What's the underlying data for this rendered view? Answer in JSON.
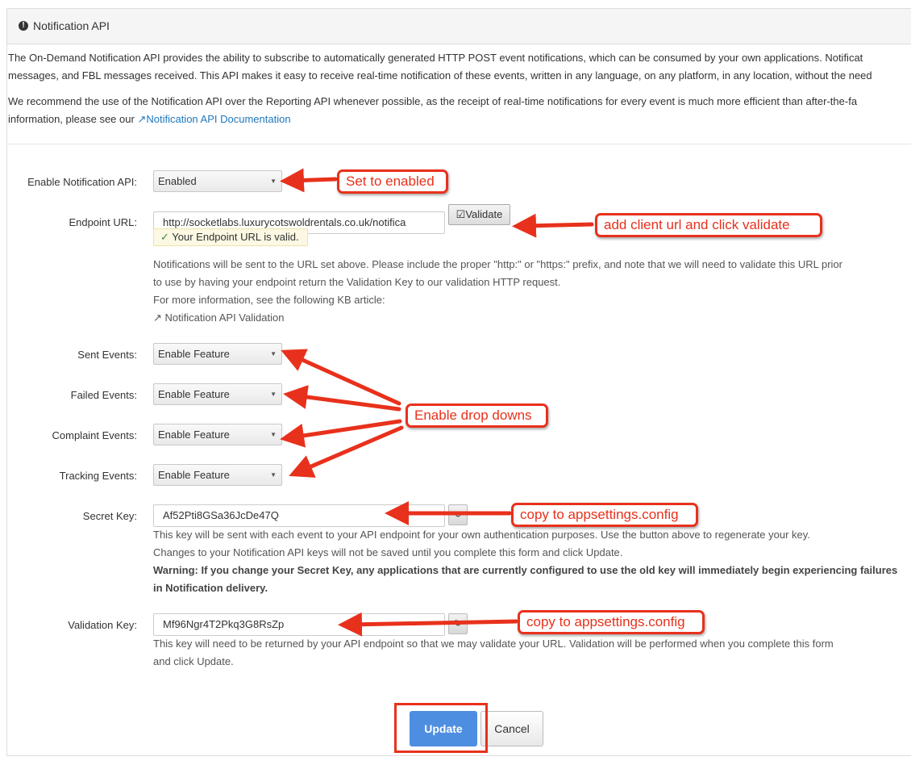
{
  "panel": {
    "title": "Notification API",
    "intro_line1": "The On-Demand Notification API provides the ability to subscribe to automatically generated HTTP POST event notifications, which can be consumed by your own applications. Notificat",
    "intro_line2": "messages, and FBL messages received. This API makes it easy to receive real-time notification of these events, written in any language, on any platform, in any location, without the need",
    "intro_line3": "We recommend the use of the Notification API over the Reporting API whenever possible, as the receipt of real-time notifications for every event is much more efficient than after-the-fa",
    "intro_line4_prefix": "information, please see our",
    "docs_link": "Notification API Documentation"
  },
  "form": {
    "enable_label": "Enable Notification API:",
    "enable_value": "Enabled",
    "endpoint_label": "Endpoint URL:",
    "endpoint_value": "http://socketlabs.luxurycotswoldrentals.co.uk/notifica",
    "validate_label": "Validate",
    "valid_msg": "Your Endpoint URL is valid.",
    "endpoint_help1": "Notifications will be sent to the URL set above. Please include the proper \"http:\" or \"https:\" prefix, and note that we will need to validate this URL prior",
    "endpoint_help2": "to use by having your endpoint return the Validation Key to our validation HTTP request.",
    "endpoint_help3": "For more information, see the following KB article:",
    "kb_link": "Notification API Validation",
    "sent_label": "Sent Events:",
    "sent_value": "Enable Feature",
    "failed_label": "Failed Events:",
    "failed_value": "Enable Feature",
    "complaint_label": "Complaint Events:",
    "complaint_value": "Enable Feature",
    "tracking_label": "Tracking Events:",
    "tracking_value": "Enable Feature",
    "secret_label": "Secret Key:",
    "secret_value": "Af52Pti8GSa36JcDe47Q",
    "secret_help1": "This key will be sent with each event to your API endpoint for your own authentication purposes. Use the button above to regenerate your key.",
    "secret_help2": "Changes to your Notification API keys will not be saved until you complete this form and click Update.",
    "secret_warning1": "Warning: If you change your Secret Key, any applications that are currently configured to use the old key will immediately begin experiencing failures",
    "secret_warning2": "in Notification delivery.",
    "validation_label": "Validation Key:",
    "validation_value": "Mf96Ngr4T2Pkq3G8RsZp",
    "validation_help1": "This key will need to be returned by your API endpoint so that we may validate your URL. Validation will be performed when you complete this form",
    "validation_help2": "and click Update.",
    "update_label": "Update",
    "cancel_label": "Cancel"
  },
  "annotations": {
    "set_enabled": "Set to enabled",
    "add_client_url": "add client url and click validate",
    "enable_dropdowns": "Enable drop downs",
    "copy_secret": "copy to appsettings.config",
    "copy_validation": "copy to appsettings.config",
    "accent_color": "#e8311c"
  },
  "icons": {
    "heading": "exclamation-circle-icon",
    "external_link": "external-link-icon",
    "check": "check-icon",
    "regenerate": "refresh-icon",
    "dropdown": "chevron-down-icon"
  }
}
